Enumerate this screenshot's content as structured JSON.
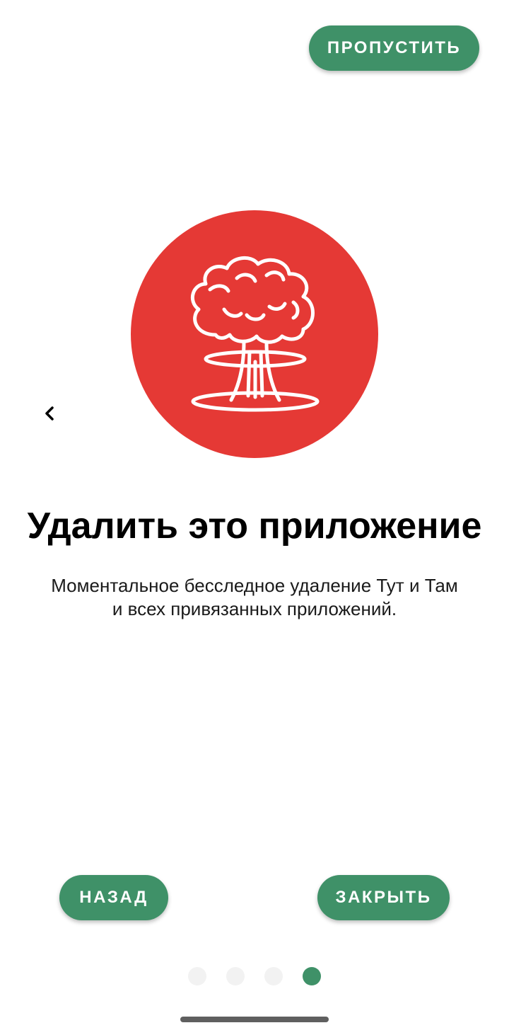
{
  "header": {
    "skip_label": "ПРОПУСТИТЬ"
  },
  "slide": {
    "illustration_icon": "mushroom-cloud-icon",
    "illustration_bg_color": "#e53935",
    "title": "Удалить это приложение",
    "description_line1": "Моментальное бесследное удаление Тут и Там",
    "description_line2": "и всех привязанных приложений."
  },
  "navigation": {
    "prev_icon": "chevron-left-icon",
    "back_label": "НАЗАД",
    "close_label": "ЗАКРЫТЬ"
  },
  "pager": {
    "total_pages": 4,
    "active_page": 4
  },
  "colors": {
    "accent": "#3f9168",
    "inactive_dot": "#f2f2f2"
  }
}
